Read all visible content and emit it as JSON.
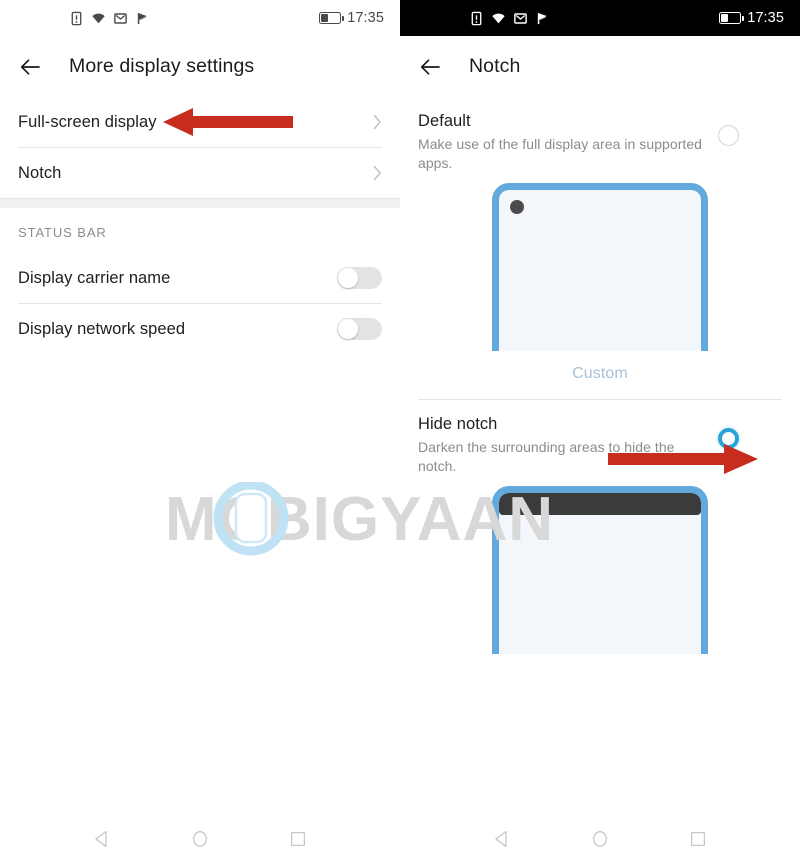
{
  "left_screen": {
    "status_bar": {
      "time": "17:35",
      "icons": [
        "sim-alert-icon",
        "wifi-icon",
        "mail-icon",
        "play-badge-icon"
      ],
      "battery_label": "battery-icon",
      "theme": "light"
    },
    "app_bar": {
      "title": "More display settings",
      "back_label": "back-arrow"
    },
    "rows": [
      {
        "label": "Full-screen display",
        "type": "link"
      },
      {
        "label": "Notch",
        "type": "link"
      }
    ],
    "section": {
      "header": "STATUS BAR",
      "toggles": [
        {
          "label": "Display carrier name",
          "state": "off"
        },
        {
          "label": "Display network speed",
          "state": "off"
        }
      ]
    }
  },
  "right_screen": {
    "status_bar": {
      "time": "17:35",
      "icons": [
        "sim-alert-icon",
        "wifi-icon",
        "mail-icon",
        "play-badge-icon"
      ],
      "battery_label": "battery-icon",
      "theme": "dark"
    },
    "app_bar": {
      "title": "Notch",
      "back_label": "back-arrow"
    },
    "options": [
      {
        "title": "Default",
        "desc": "Make use of the full display area in supported apps.",
        "selected": false,
        "preview_caption": "Custom"
      },
      {
        "title": "Hide notch",
        "desc": "Darken the surrounding areas to hide the notch.",
        "selected": true,
        "preview_caption": ""
      }
    ]
  },
  "nav_bar": {
    "items": [
      "back-triangle-icon",
      "home-circle-icon",
      "recents-square-icon"
    ]
  },
  "annotations": {
    "arrows": [
      {
        "name": "arrow-pointing-to-full-screen-display",
        "direction": "left"
      },
      {
        "name": "arrow-pointing-to-hide-notch-radio",
        "direction": "right"
      }
    ],
    "color": "#c62d1f"
  },
  "watermark": {
    "text": "MOBIGYAAN"
  },
  "colors": {
    "accent_radio": "#29a3d8",
    "preview_frame": "#63a9dc",
    "preview_screen": "#f3f7fc",
    "notch_bar": "#3b3b3b",
    "custom_text": "#a9c2d4",
    "arrow_red": "#c62d1f"
  }
}
